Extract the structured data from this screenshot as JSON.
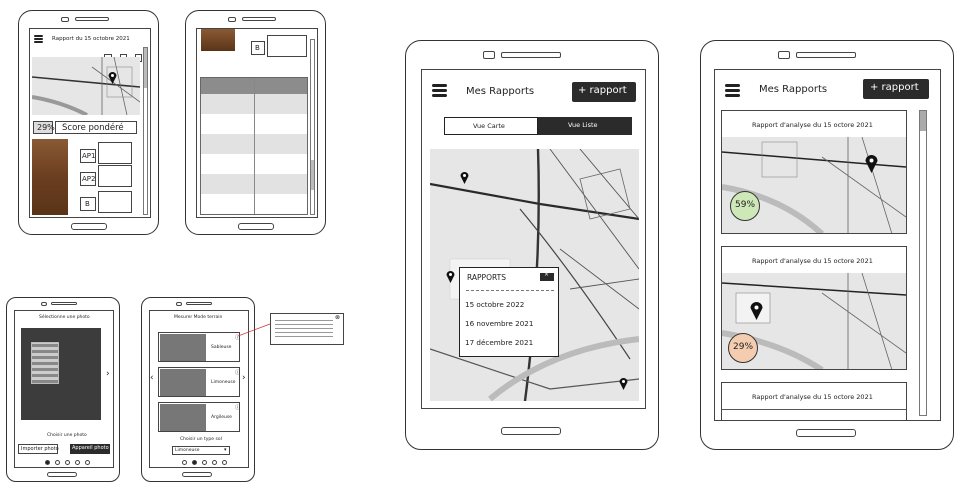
{
  "colors": {
    "accent_dark": "#2b2b2b",
    "score_green": "#cfe8b8",
    "score_orange": "#f4cdb0",
    "map_bg": "#e6e6e6",
    "dirt": "#7a4a28"
  },
  "phone1": {
    "title": "Rapport du 15 octobre 2021",
    "score": "29%",
    "score_label": "Score pondéré",
    "horizons": [
      "AP1",
      "AP2",
      "B"
    ]
  },
  "phone2": {
    "horizon": "B",
    "table_headers": [
      "",
      "",
      ""
    ],
    "rows": [
      "",
      "",
      "",
      "",
      "",
      ""
    ]
  },
  "phone3": {
    "title": "Sélectionne une photo",
    "import_btn": "Importer photo",
    "camera_btn": "Appareil photo",
    "prompt": "Choisir une photo"
  },
  "phone4": {
    "title": "Mesurer Mode terrain",
    "options": [
      "Sableuse",
      "Limoneuse",
      "Argileuse"
    ],
    "prompt": "Choisir un type sol",
    "select_value": "Limoneuse"
  },
  "phone5": {
    "title": "Mes Rapports",
    "add_btn": "+ rapport",
    "tab_map": "Vue Carte",
    "tab_list": "Vue Liste",
    "popup_title": "RAPPORTS",
    "popup_items": [
      "15 octobre 2022",
      "16 novembre 2021",
      "17 décembre 2021"
    ]
  },
  "phone6": {
    "title": "Mes Rapports",
    "add_btn": "+ rapport",
    "cards": [
      {
        "title": "Rapport d'analyse du 15 octore 2021",
        "score": "59%"
      },
      {
        "title": "Rapport d'analyse du 15 octore 2021",
        "score": "29%"
      },
      {
        "title": "Rapport d'analyse du 15 octore 2021"
      }
    ]
  }
}
